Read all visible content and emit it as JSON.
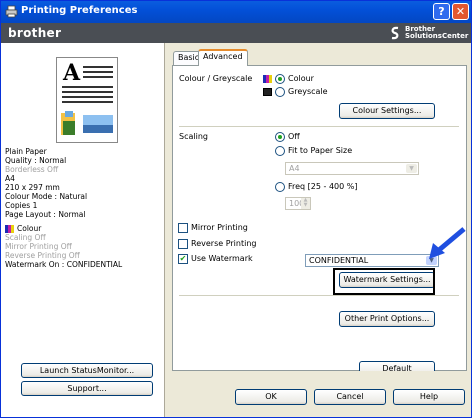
{
  "window": {
    "title": "Printing Preferences"
  },
  "brand": {
    "logo": "brother",
    "solutions_line1": "Brother",
    "solutions_line2": "SolutionsCenter"
  },
  "left": {
    "summary": [
      {
        "text": "Plain Paper",
        "dim": false
      },
      {
        "text": "Quality : Normal",
        "dim": false
      },
      {
        "text": "Borderless Off",
        "dim": true
      },
      {
        "text": "A4",
        "dim": false
      },
      {
        "text": "210 x 297 mm",
        "dim": false
      },
      {
        "text": "Colour Mode : Natural",
        "dim": false
      },
      {
        "text": "Copies 1",
        "dim": false
      },
      {
        "text": "Page Layout : Normal",
        "dim": false
      }
    ],
    "colour_label": "Colour",
    "status": [
      {
        "text": "Scaling Off",
        "dim": true
      },
      {
        "text": "Mirror Printing Off",
        "dim": true
      },
      {
        "text": "Reverse Printing Off",
        "dim": true
      },
      {
        "text": "Watermark On : CONFIDENTIAL",
        "dim": false
      }
    ],
    "launch_button": "Launch StatusMonitor...",
    "support_button": "Support..."
  },
  "tabs": [
    {
      "label": "Basic"
    },
    {
      "label": "Advanced"
    }
  ],
  "advanced": {
    "colour_greyscale_label": "Colour / Greyscale",
    "colour_option": "Colour",
    "greyscale_option": "Greyscale",
    "colour_settings_button": "Colour Settings...",
    "scaling_label": "Scaling",
    "scaling_off": "Off",
    "fit_to_paper": "Fit to Paper Size",
    "paper_size_value": "A4",
    "freq": "Freq [25 - 400 %]",
    "freq_value": "100",
    "mirror_printing": "Mirror Printing",
    "reverse_printing": "Reverse Printing",
    "use_watermark": "Use Watermark",
    "watermark_value": "CONFIDENTIAL",
    "watermark_settings_button": "Watermark Settings...",
    "other_print_options_button": "Other Print Options...",
    "default_button": "Default"
  },
  "footer": {
    "ok": "OK",
    "cancel": "Cancel",
    "help": "Help"
  }
}
